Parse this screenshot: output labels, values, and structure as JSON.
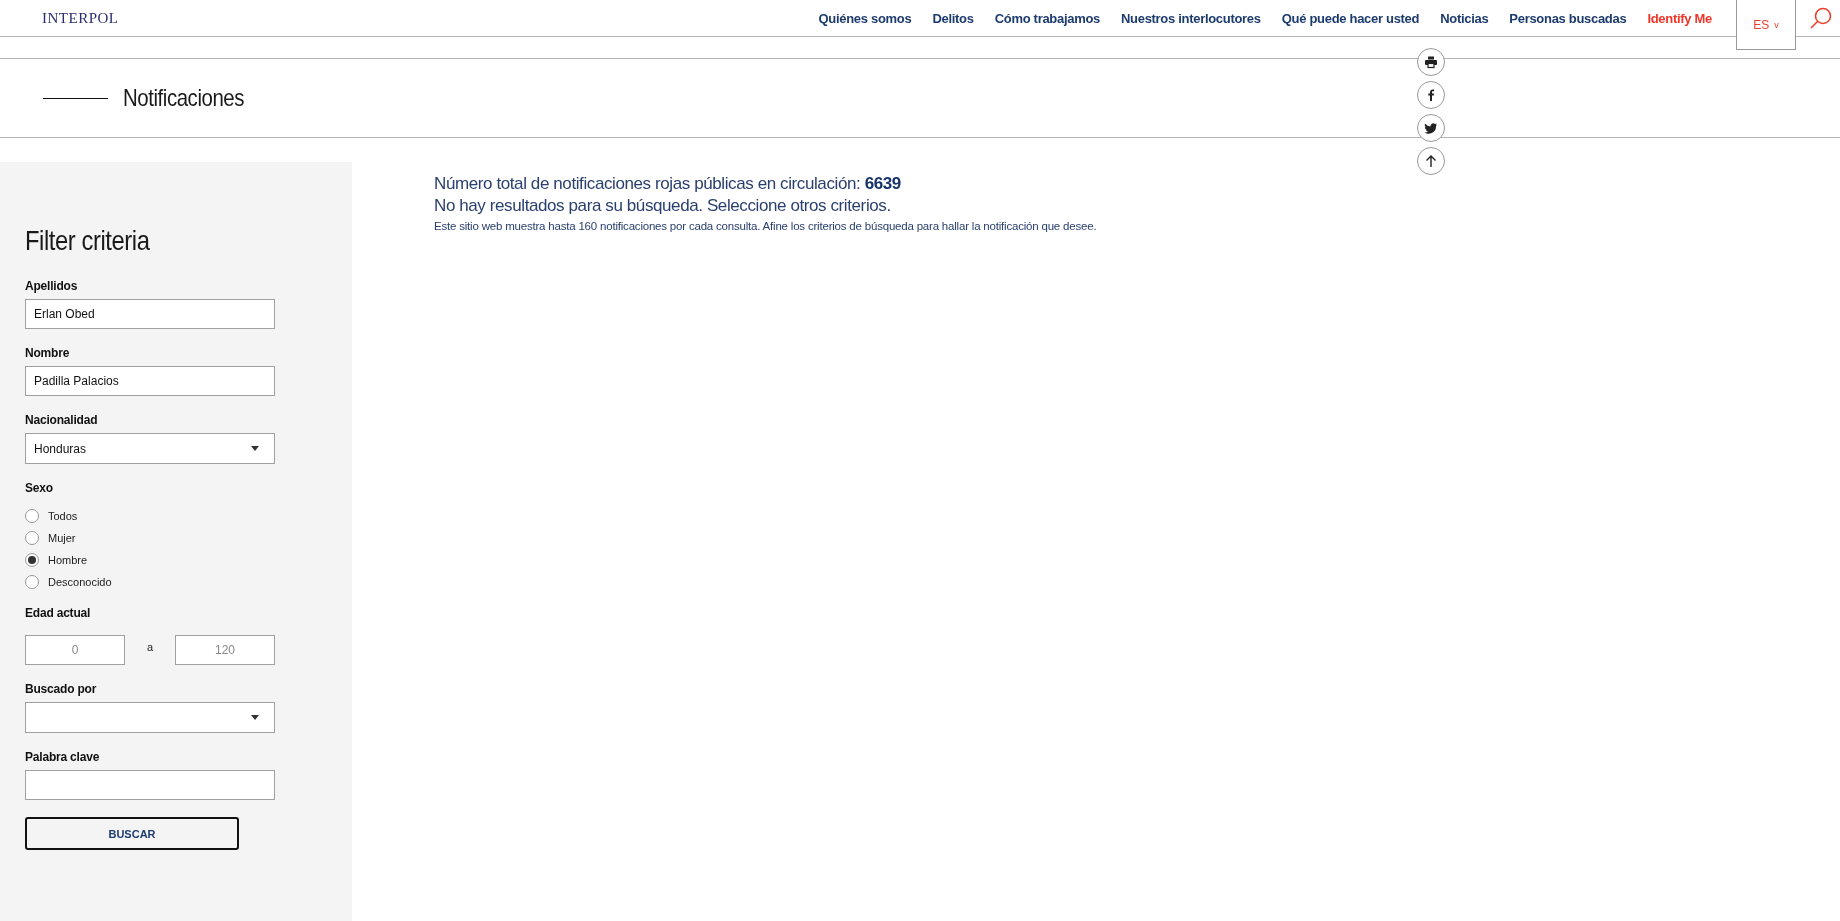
{
  "header": {
    "logo": "INTERPOL",
    "nav": [
      {
        "label": "Quiénes somos",
        "kind": "normal"
      },
      {
        "label": "Delitos",
        "kind": "normal"
      },
      {
        "label": "Cómo trabajamos",
        "kind": "normal"
      },
      {
        "label": "Nuestros interlocutores",
        "kind": "normal"
      },
      {
        "label": "Qué puede hacer usted",
        "kind": "normal"
      },
      {
        "label": "Noticias",
        "kind": "normal"
      },
      {
        "label": "Personas buscadas",
        "kind": "normal"
      },
      {
        "label": "Identify Me",
        "kind": "highlight"
      }
    ],
    "language": "ES",
    "language_caret": "v"
  },
  "page_title": "Notificaciones",
  "summary": {
    "total_text": "Número total de notificaciones rojas públicas en circulación: **6639**",
    "no_results": "No hay resultados para su búsqueda. Seleccione otros criterios.",
    "note": "Este sitio web muestra hasta 160 notificaciones por cada consulta. Afine los criterios de búsqueda para hallar la notificación que desee."
  },
  "filter": {
    "title": "Filter criteria",
    "fields": [
      {
        "kind": "text",
        "label": "Apellidos",
        "value": "Erlan Obed"
      },
      {
        "kind": "text",
        "label": "Nombre",
        "value": "Padilla Palacios"
      },
      {
        "kind": "select",
        "label": "Nacionalidad",
        "value": "Honduras"
      },
      {
        "kind": "radio",
        "label": "Sexo",
        "options": [
          {
            "label": "Todos",
            "selected": false
          },
          {
            "label": "Mujer",
            "selected": false
          },
          {
            "label": "Hombre",
            "selected": true
          },
          {
            "label": "Desconocido",
            "selected": false
          }
        ]
      },
      {
        "kind": "range",
        "label": "Edad actual",
        "from_placeholder": "0",
        "separator": "a",
        "to_placeholder": "120"
      },
      {
        "kind": "select",
        "label": "Buscado por"
      },
      {
        "kind": "text",
        "label": "Palabra clave"
      }
    ],
    "submit": "BUSCAR"
  }
}
